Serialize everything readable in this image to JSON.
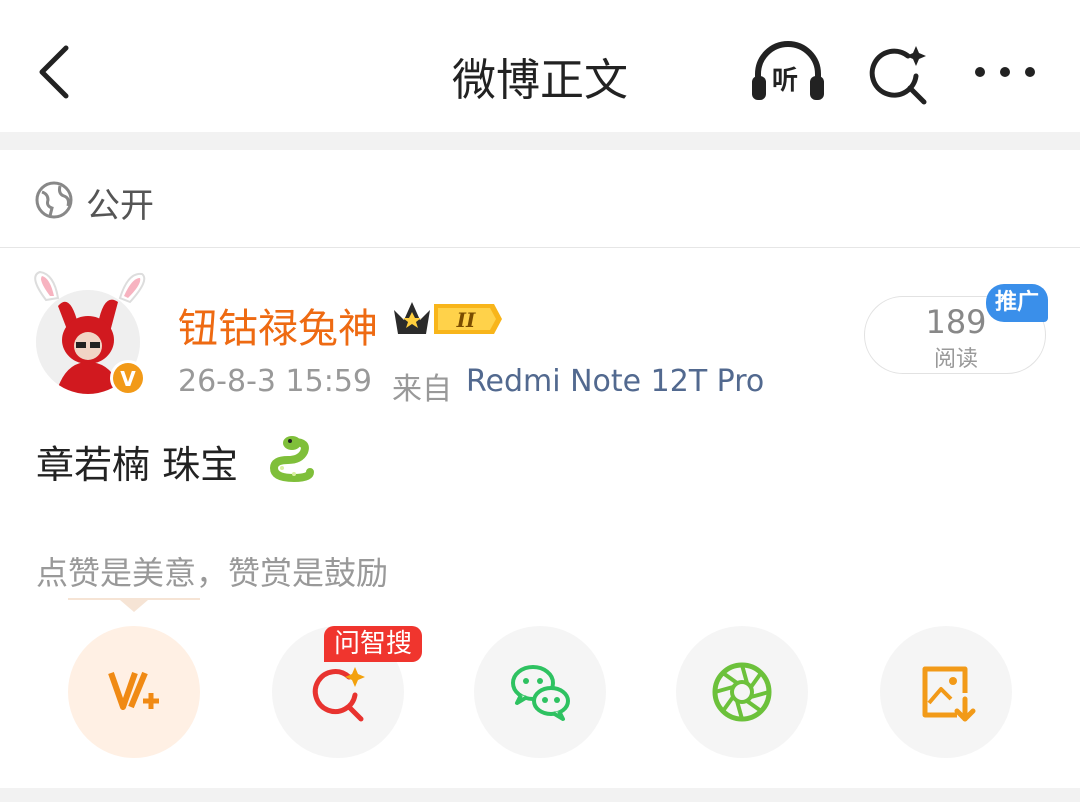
{
  "header": {
    "title": "微博正文",
    "listen_label": "听",
    "icons": [
      "back-arrow-icon",
      "headphones-icon",
      "ai-search-icon",
      "more-dots-icon"
    ]
  },
  "visibility": {
    "icon": "globe-icon",
    "label": "公开"
  },
  "post": {
    "author": "钮钴禄兔神",
    "verified_badge": "V",
    "crown_level": "II",
    "time": "26-8-3 15:59",
    "from_label": "来自",
    "device": "Redmi Note 12T Pro",
    "read_count": "189",
    "read_label": "阅读",
    "promo_badge": "推广",
    "text": "章若楠  珠宝",
    "emoji": "snake-icon"
  },
  "reward": {
    "tip": "点赞是美意，赞赏是鼓励"
  },
  "actions": {
    "ask_badge": "问智搜",
    "items": [
      "reward-v-plus-icon",
      "ask-search-icon",
      "wechat-icon",
      "moments-icon",
      "save-image-icon"
    ]
  },
  "colors": {
    "author": "#ee6a12",
    "device_link": "#52698f",
    "promo": "#3a8fea",
    "badge_red": "#f0352e",
    "reward_bg": "#fff0e4"
  }
}
